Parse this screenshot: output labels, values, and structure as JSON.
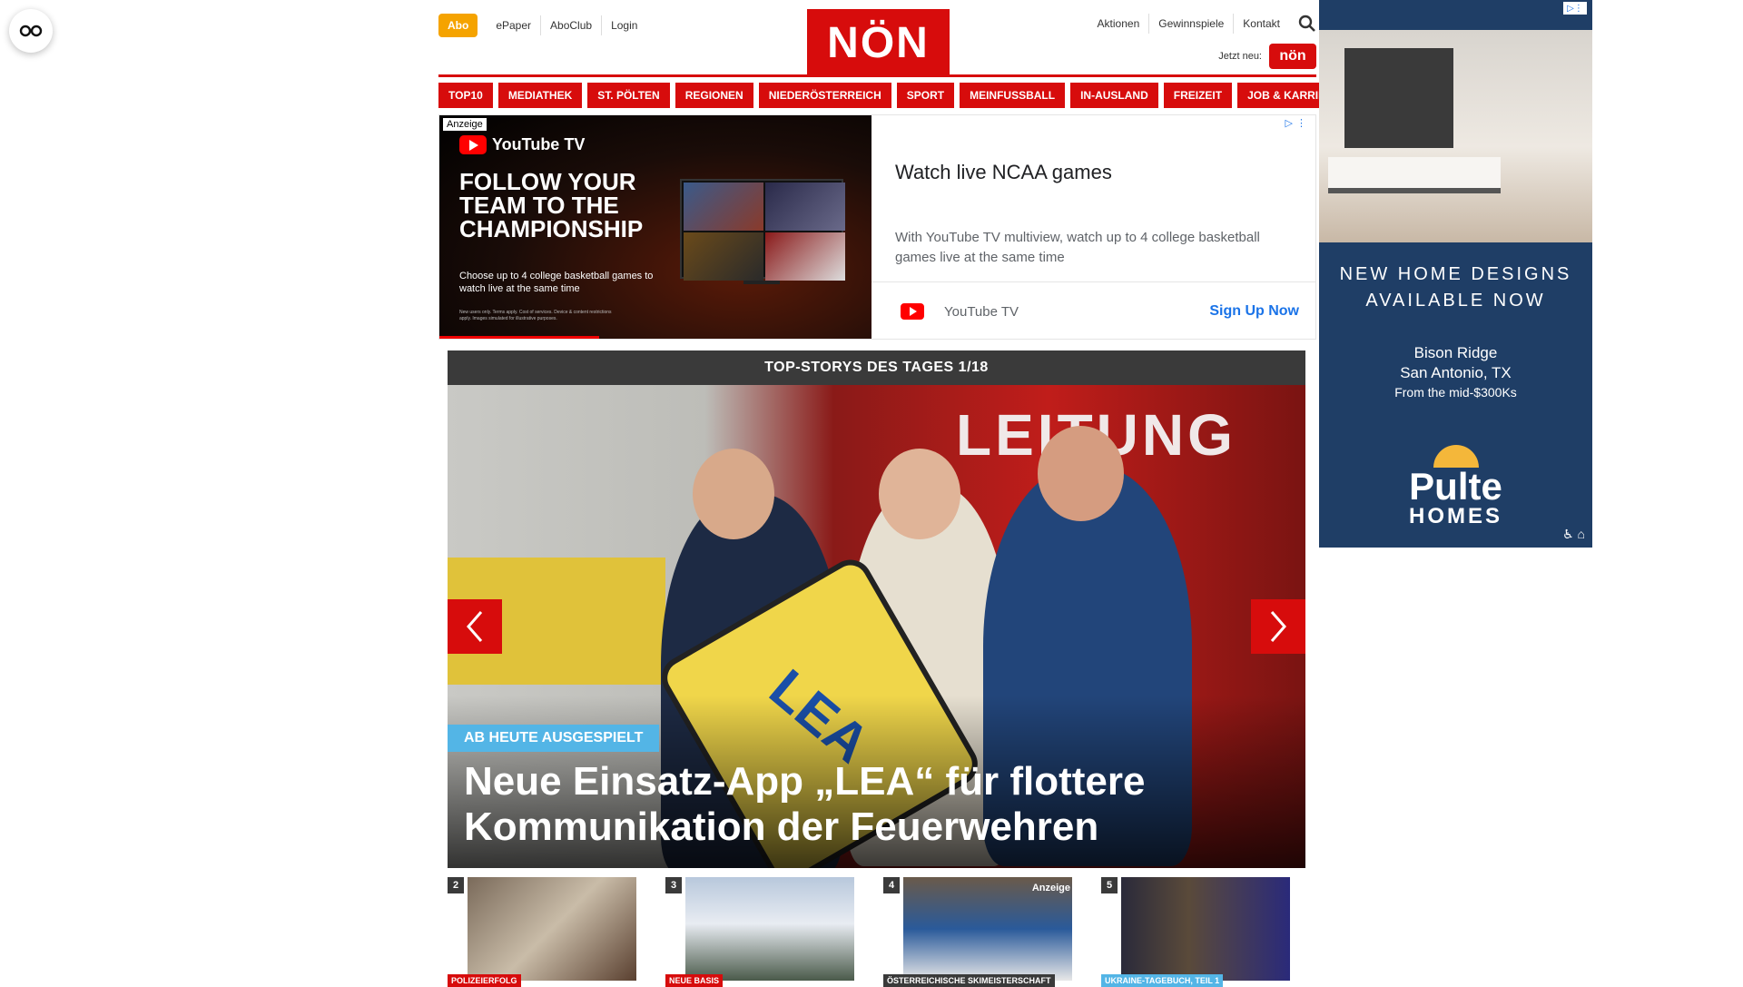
{
  "topbar": {
    "abo": "Abo",
    "left_links": [
      "ePaper",
      "AboClub",
      "Login"
    ],
    "logo": "NÖN",
    "right_links": [
      "Aktionen",
      "Gewinnspiele",
      "Kontakt"
    ],
    "jetzt_label": "Jetzt neu:",
    "jetzt_badge": "nön"
  },
  "categories": [
    "TOP10",
    "MEDIATHEK",
    "ST. PÖLTEN",
    "REGIONEN",
    "NIEDERÖSTERREICH",
    "SPORT",
    "MEINFUSSBALL",
    "IN-AUSLAND",
    "FREIZEIT",
    "JOB & KARRIERE"
  ],
  "ad_banner": {
    "anzeige": "Anzeige",
    "brand": "YouTube TV",
    "headline": "FOLLOW YOUR TEAM TO THE CHAMPIONSHIP",
    "sub": "Choose up to 4 college basketball games to watch live at the same time",
    "fine_print": "New users only. Terms apply. Cost of services. Device & content restrictions apply. Images simulated for illustrative purposes.",
    "title": "Watch live NCAA games",
    "description": "With YouTube TV multiview, watch up to 4 college basketball games live at the same time",
    "advertiser": "YouTube TV",
    "cta": "Sign Up Now",
    "progress_fraction": 0.37
  },
  "hero": {
    "bar_title": "TOP-STORYS DES TAGES 1/18",
    "truck_text": "LEITUNG",
    "sign_text": "LEA",
    "badge": "AB HEUTE AUSGESPIELT",
    "title": "Neue Einsatz-App „LEA“ für flottere Kommunikation der Feuerwehren"
  },
  "thumbnails": [
    {
      "num": "2",
      "tag": "POLIZEIERFOLG",
      "tag_color": "#d70c0c",
      "ad": ""
    },
    {
      "num": "3",
      "tag": "NEUE BASIS",
      "tag_color": "#d70c0c",
      "ad": ""
    },
    {
      "num": "4",
      "tag": "ÖSTERREICHISCHE SKIMEISTERSCHAFT",
      "tag_color": "#3a3a3a",
      "ad": "Anzeige"
    },
    {
      "num": "5",
      "tag": "UKRAINE-TAGEBUCH, TEIL 1",
      "tag_color": "#53b5e6",
      "ad": ""
    }
  ],
  "side_ad": {
    "headline": "NEW HOME DESIGNS AVAILABLE NOW",
    "community": "Bison Ridge",
    "city": "San Antonio, TX",
    "price": "From the mid-$300Ks",
    "brand_top": "Pulte",
    "brand_bottom": "HOMES",
    "footer_icons": "♿ ⌂"
  },
  "colors": {
    "brand_red": "#d70c0c",
    "abo_orange": "#f5a300",
    "badge_blue": "#53b5e6",
    "side_ad_navy": "#1f3e66"
  }
}
